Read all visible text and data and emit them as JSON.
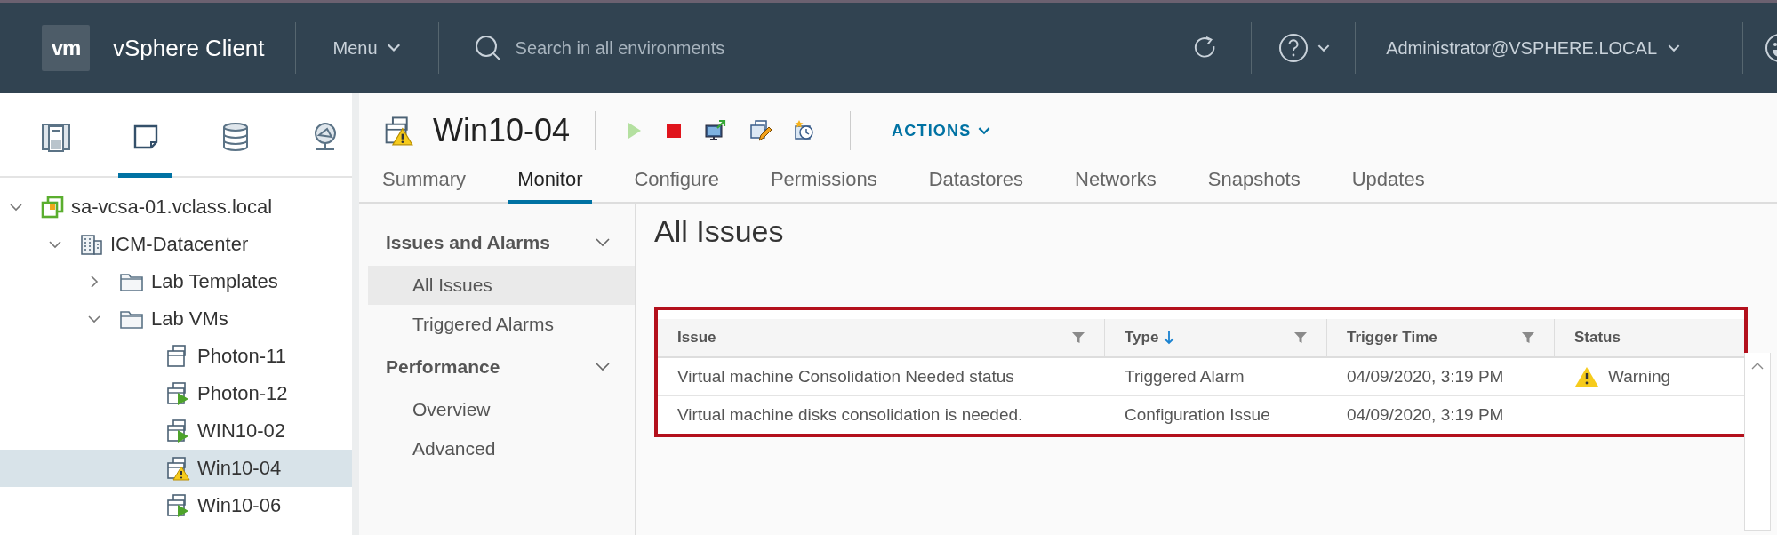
{
  "header": {
    "logo": "vm",
    "app_title": "vSphere Client",
    "menu": "Menu",
    "search": {
      "placeholder": "Search in all environments"
    },
    "user": "Administrator@VSPHERE.LOCAL"
  },
  "sidebar": {
    "views": [
      {
        "kind": "hosts",
        "selected": false
      },
      {
        "kind": "vms",
        "selected": true
      },
      {
        "kind": "storage",
        "selected": false
      },
      {
        "kind": "network",
        "selected": false
      }
    ],
    "tree": [
      {
        "label": "sa-vcsa-01.vclass.local",
        "kind": "vcenter",
        "expanded": true,
        "selected": false,
        "children": [
          {
            "label": "ICM-Datacenter",
            "kind": "datacenter",
            "expanded": true,
            "selected": false,
            "children": [
              {
                "label": "Lab Templates",
                "kind": "folder",
                "expanded": false,
                "selected": false
              },
              {
                "label": "Lab VMs",
                "kind": "folder",
                "expanded": true,
                "selected": false,
                "children": [
                  {
                    "label": "Photon-11",
                    "kind": "vm-off",
                    "selected": false
                  },
                  {
                    "label": "Photon-12",
                    "kind": "vm-on",
                    "selected": false
                  },
                  {
                    "label": "WIN10-02",
                    "kind": "vm-on",
                    "selected": false
                  },
                  {
                    "label": "Win10-04",
                    "kind": "vm-warning",
                    "selected": true
                  },
                  {
                    "label": "Win10-06",
                    "kind": "vm-on",
                    "selected": false
                  }
                ]
              }
            ]
          }
        ]
      }
    ]
  },
  "object": {
    "title": "Win10-04",
    "kind": "vm-warning",
    "actions": [
      {
        "kind": "power-on",
        "disabled": true
      },
      {
        "kind": "power-off",
        "disabled": false
      },
      {
        "kind": "console",
        "disabled": false
      },
      {
        "kind": "edit",
        "disabled": false
      },
      {
        "kind": "snapshot",
        "disabled": false
      }
    ],
    "actions_menu": "ACTIONS"
  },
  "tabs": [
    {
      "label": "Summary",
      "selected": false
    },
    {
      "label": "Monitor",
      "selected": true
    },
    {
      "label": "Configure",
      "selected": false
    },
    {
      "label": "Permissions",
      "selected": false
    },
    {
      "label": "Datastores",
      "selected": false
    },
    {
      "label": "Networks",
      "selected": false
    },
    {
      "label": "Snapshots",
      "selected": false
    },
    {
      "label": "Updates",
      "selected": false
    }
  ],
  "monitor_nav": [
    {
      "label": "Issues and Alarms",
      "expanded": true,
      "items": [
        {
          "label": "All Issues",
          "selected": true
        },
        {
          "label": "Triggered Alarms",
          "selected": false
        }
      ]
    },
    {
      "label": "Performance",
      "expanded": true,
      "items": [
        {
          "label": "Overview",
          "selected": false
        },
        {
          "label": "Advanced",
          "selected": false
        }
      ]
    }
  ],
  "page_title": "All Issues",
  "table": {
    "columns": [
      {
        "label": "Issue",
        "sorted_descending": false,
        "filter": true
      },
      {
        "label": "Type",
        "sorted_descending": true,
        "filter": true
      },
      {
        "label": "Trigger Time",
        "sorted_descending": false,
        "filter": true
      },
      {
        "label": "Status",
        "sorted_descending": false,
        "filter": false
      }
    ],
    "rows": [
      {
        "issue": "Virtual machine Consolidation Needed status",
        "type": "Triggered Alarm",
        "trigger_time": "04/09/2020, 3:19 PM",
        "status": {
          "kind": "warning",
          "label": "Warning"
        }
      },
      {
        "issue": "Virtual machine disks consolidation is needed.",
        "type": "Configuration Issue",
        "trigger_time": "04/09/2020, 3:19 PM"
      }
    ]
  }
}
